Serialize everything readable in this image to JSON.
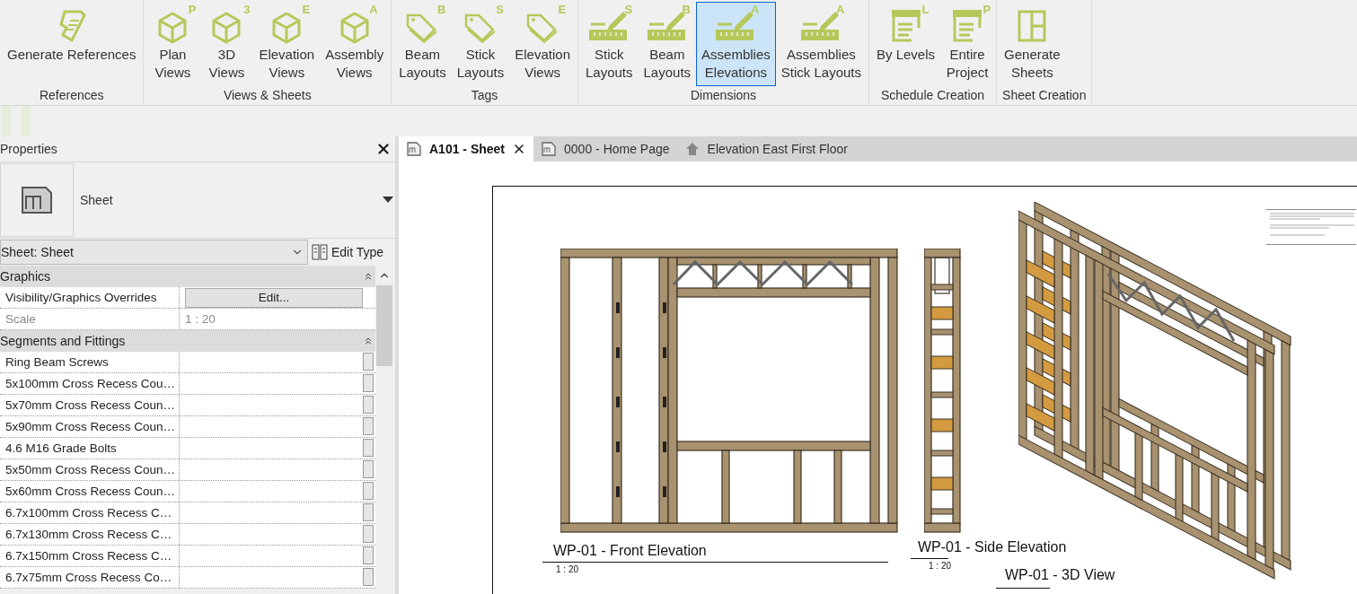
{
  "ribbon": {
    "groups": [
      {
        "label": "References",
        "buttons": [
          {
            "kind": "scroll",
            "label": "Generate References",
            "selected": false
          }
        ]
      },
      {
        "label": "Views & Sheets",
        "buttons": [
          {
            "kind": "cube",
            "badge": "P",
            "label": "Plan\nViews",
            "selected": false
          },
          {
            "kind": "cube",
            "badge": "3",
            "label": "3D\nViews",
            "selected": false
          },
          {
            "kind": "cube",
            "badge": "E",
            "label": "Elevation\nViews",
            "selected": false
          },
          {
            "kind": "cube",
            "badge": "A",
            "label": "Assembly\nViews",
            "selected": false
          }
        ]
      },
      {
        "label": "Tags",
        "buttons": [
          {
            "kind": "tag",
            "badge": "B",
            "label": "Beam\nLayouts",
            "selected": false
          },
          {
            "kind": "tag",
            "badge": "S",
            "label": "Stick\nLayouts",
            "selected": false
          },
          {
            "kind": "tag",
            "badge": "E",
            "label": "Elevation\nViews",
            "selected": false
          }
        ]
      },
      {
        "label": "Dimensions",
        "buttons": [
          {
            "kind": "ruler",
            "badge": "S",
            "label": "Stick\nLayouts",
            "selected": false
          },
          {
            "kind": "ruler",
            "badge": "B",
            "label": "Beam\nLayouts",
            "selected": false
          },
          {
            "kind": "ruler",
            "badge": "A",
            "label": "Assemblies\nElevations",
            "selected": true
          },
          {
            "kind": "ruler",
            "badge": "A",
            "label": "Assemblies\nStick Layouts",
            "selected": false
          }
        ]
      },
      {
        "label": "Schedule Creation",
        "buttons": [
          {
            "kind": "schedule",
            "badge": "L",
            "label": "By Levels",
            "selected": false
          },
          {
            "kind": "schedule",
            "badge": "P",
            "label": "Entire\nProject",
            "selected": false
          }
        ]
      },
      {
        "label": "Sheet Creation",
        "buttons": [
          {
            "kind": "sheet",
            "label": "Generate\nSheets",
            "selected": false
          }
        ]
      }
    ]
  },
  "properties": {
    "title": "Properties",
    "type_name": "Sheet",
    "type_selector": "Sheet: Sheet",
    "edit_type": "Edit Type",
    "groups": [
      {
        "name": "Graphics",
        "expanded": true,
        "rows": [
          {
            "name": "Visibility/Graphics Overrides",
            "kind": "button",
            "value": "Edit...",
            "disabled": false
          },
          {
            "name": "Scale",
            "kind": "text",
            "value": "1 : 20",
            "disabled": true
          }
        ]
      },
      {
        "name": "Segments and Fittings",
        "expanded": true,
        "rows": [
          {
            "name": "Ring Beam Screws",
            "kind": "box",
            "disabled": false
          },
          {
            "name": "5x100mm Cross Recess Cou…",
            "kind": "box",
            "disabled": false
          },
          {
            "name": "5x70mm Cross Recess Coun…",
            "kind": "box",
            "disabled": false
          },
          {
            "name": "5x90mm Cross Recess Coun…",
            "kind": "box",
            "disabled": false
          },
          {
            "name": "4.6 M16 Grade Bolts",
            "kind": "box",
            "disabled": false
          },
          {
            "name": "5x50mm Cross Recess Coun…",
            "kind": "box",
            "disabled": false
          },
          {
            "name": "5x60mm Cross Recess Coun…",
            "kind": "box",
            "disabled": false
          },
          {
            "name": "6.7x100mm Cross Recess C…",
            "kind": "box",
            "disabled": false
          },
          {
            "name": "6.7x130mm Cross Recess C…",
            "kind": "box",
            "disabled": false
          },
          {
            "name": "6.7x150mm Cross Recess C…",
            "kind": "box",
            "disabled": false
          },
          {
            "name": "6.7x75mm Cross Recess Co…",
            "kind": "box",
            "disabled": false
          }
        ]
      }
    ]
  },
  "tabs": [
    {
      "kind": "sheet",
      "label": "A101 - Sheet",
      "selected": true
    },
    {
      "kind": "sheet",
      "label": "0000 - Home Page",
      "selected": false
    },
    {
      "kind": "house",
      "label": "Elevation East First Floor",
      "selected": false
    }
  ],
  "sheet": {
    "views": [
      {
        "kind": "front",
        "title": "WP-01 - Front Elevation",
        "scale": "1 : 20"
      },
      {
        "kind": "side",
        "title": "WP-01 - Side Elevation",
        "scale": "1 : 20"
      },
      {
        "kind": "iso",
        "title": "WP-01 - 3D View"
      }
    ]
  }
}
